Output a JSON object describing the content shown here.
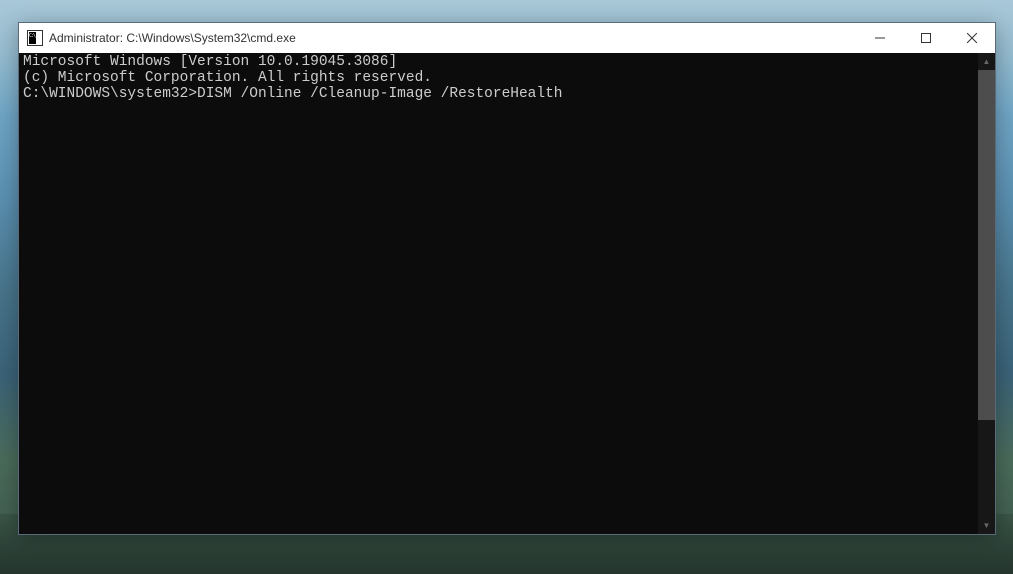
{
  "window": {
    "title": "Administrator: C:\\Windows\\System32\\cmd.exe"
  },
  "terminal": {
    "line1": "Microsoft Windows [Version 10.0.19045.3086]",
    "line2": "(c) Microsoft Corporation. All rights reserved.",
    "blank1": "",
    "prompt": "C:\\WINDOWS\\system32>",
    "command": "DISM /Online /Cleanup-Image /RestoreHealth"
  }
}
